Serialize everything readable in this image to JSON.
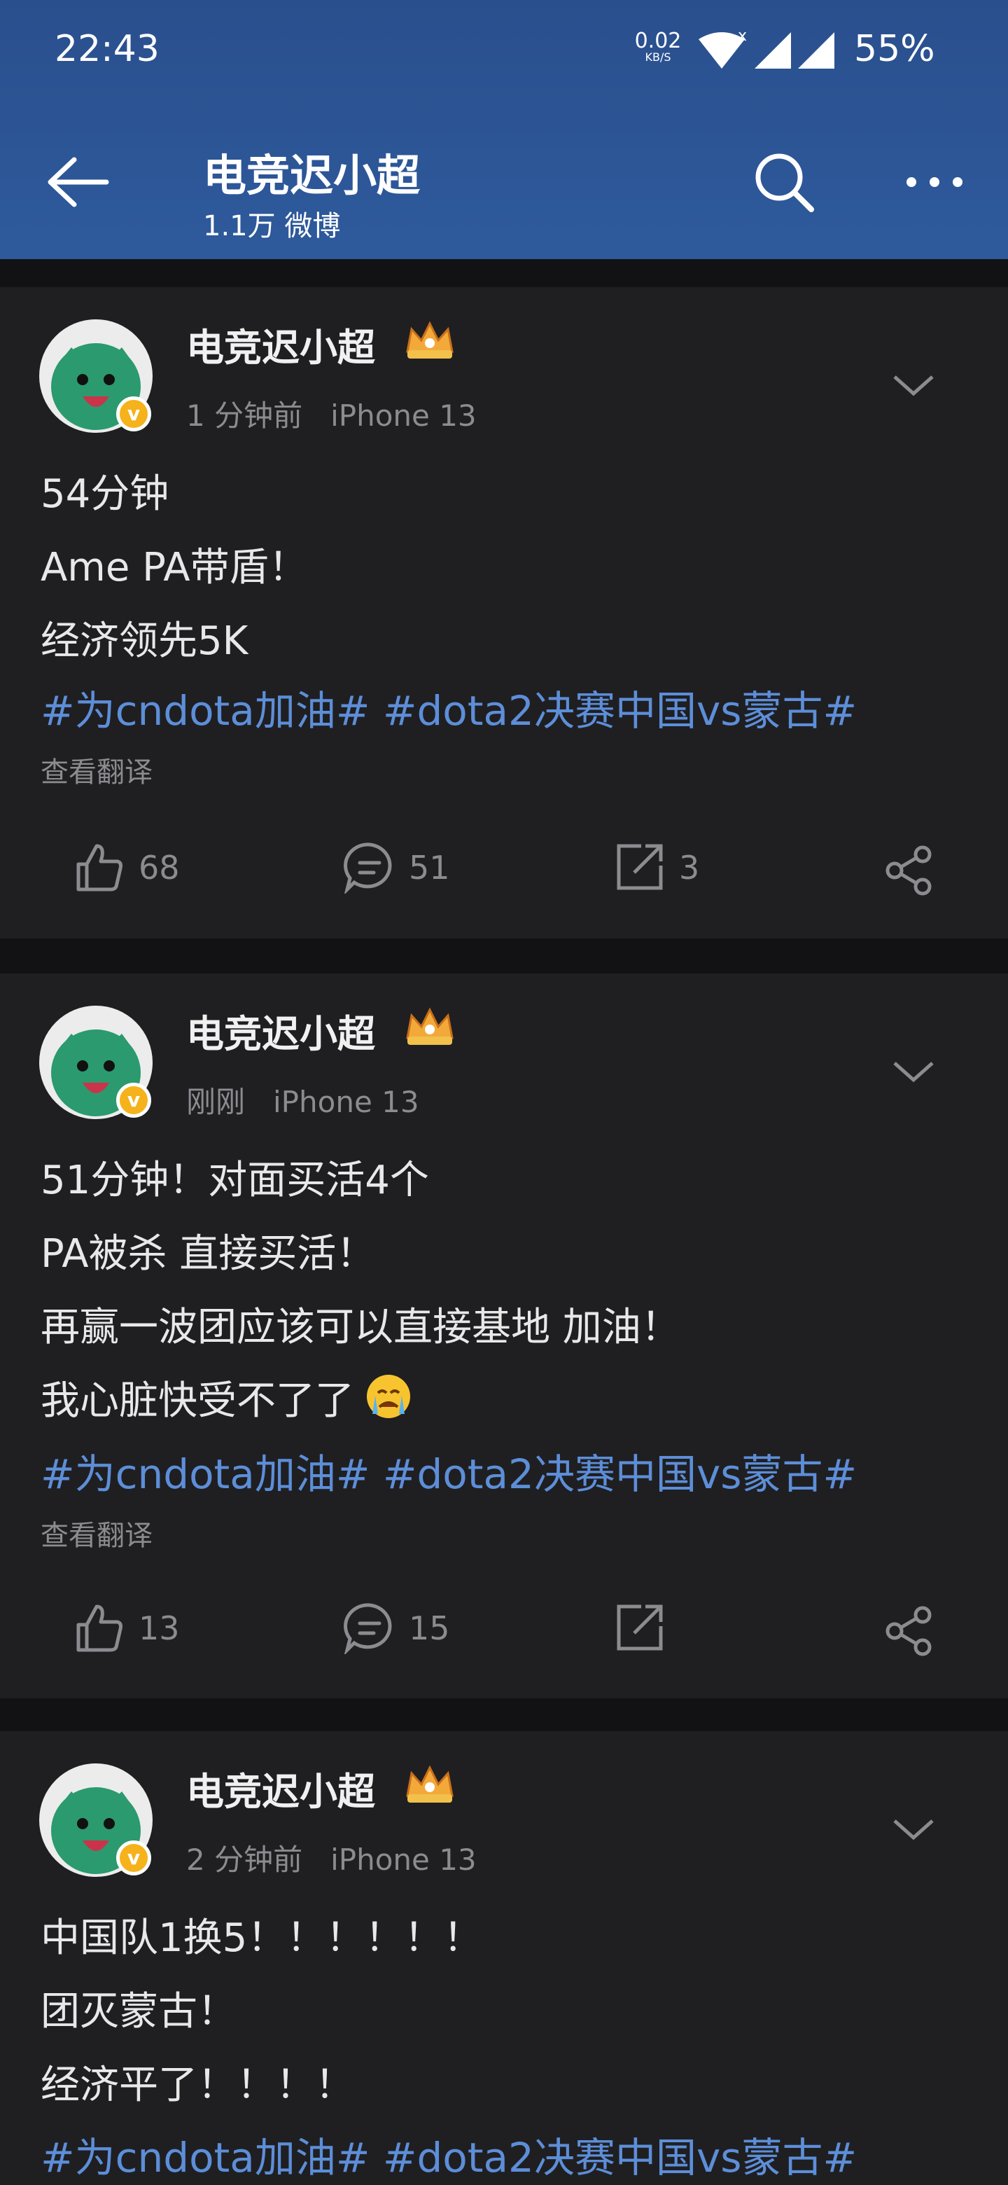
{
  "status_bar": {
    "time": "22:43",
    "net_speed_value": "0.02",
    "net_speed_unit": "KB/S",
    "battery": "55%"
  },
  "nav": {
    "title": "电竞迟小超",
    "subtitle": "1.1万 微博",
    "back_icon": "back-arrow-icon",
    "search_icon": "search-icon",
    "more_icon": "more-icon"
  },
  "colors": {
    "header": "#2e5a9c",
    "card": "#1f1f22",
    "hashtag": "#5d8ed8",
    "verified_badge": "#f5b21b"
  },
  "posts": [
    {
      "author": "电竞迟小超",
      "time": "1 分钟前",
      "device": "iPhone 13",
      "lines": [
        "54分钟",
        "Ame PA带盾！",
        "经济领先5K"
      ],
      "tags": "#为cndota加油# #dota2决赛中国vs蒙古#",
      "translate": "查看翻译",
      "likes": "68",
      "comments": "51",
      "reposts": "3"
    },
    {
      "author": "电竞迟小超",
      "time": "刚刚",
      "device": "iPhone 13",
      "lines": [
        "51分钟！对面买活4个",
        "PA被杀 直接买活！",
        "再赢一波团应该可以直接基地 加油！",
        "我心脏快受不了了"
      ],
      "tags": "#为cndota加油# #dota2决赛中国vs蒙古#",
      "translate": "查看翻译",
      "likes": "13",
      "comments": "15",
      "reposts": ""
    },
    {
      "author": "电竞迟小超",
      "time": "2 分钟前",
      "device": "iPhone 13",
      "lines": [
        "中国队1换5！！！！！！",
        "团灭蒙古！",
        "经济平了！！！！"
      ],
      "tags": "#为cndota加油# #dota2决赛中国vs蒙古#"
    }
  ]
}
